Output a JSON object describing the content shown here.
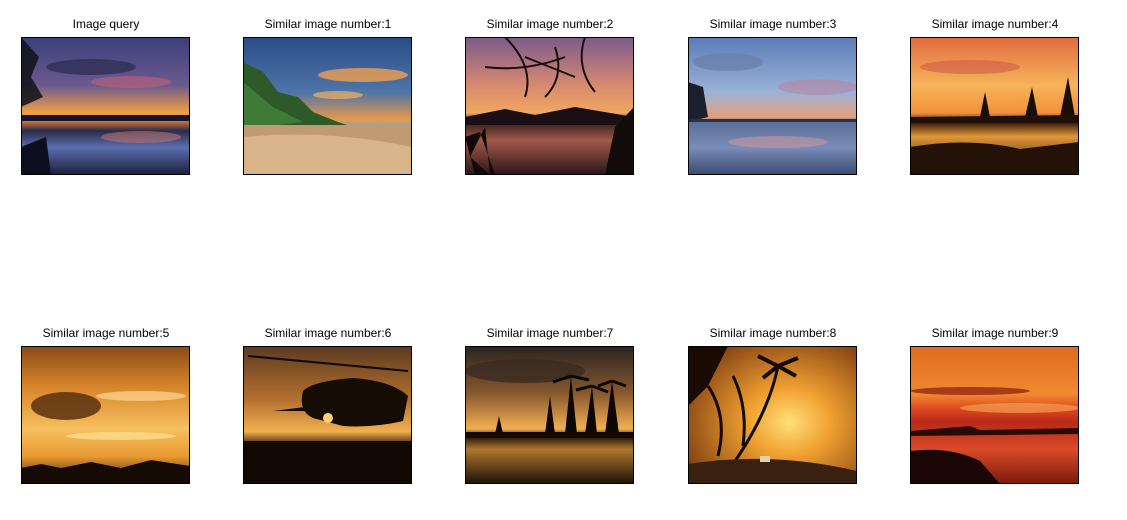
{
  "results": [
    {
      "title": "Image query",
      "image": "sunset-lake-reflection-palm"
    },
    {
      "title": "Similar image number:1",
      "image": "beach-cliffs-sunset"
    },
    {
      "title": "Similar image number:2",
      "image": "sunset-branches-silhouette"
    },
    {
      "title": "Similar image number:3",
      "image": "sunset-sea-reflection-clouds"
    },
    {
      "title": "Similar image number:4",
      "image": "orange-sunset-pond-trees"
    },
    {
      "title": "Similar image number:5",
      "image": "golden-sunset-sky-field"
    },
    {
      "title": "Similar image number:6",
      "image": "helicopter-silhouette-sunset"
    },
    {
      "title": "Similar image number:7",
      "image": "palm-trees-island-sunset"
    },
    {
      "title": "Similar image number:8",
      "image": "tropical-beach-palms-sunset"
    },
    {
      "title": "Similar image number:9",
      "image": "red-sunset-ocean-horizon"
    }
  ]
}
